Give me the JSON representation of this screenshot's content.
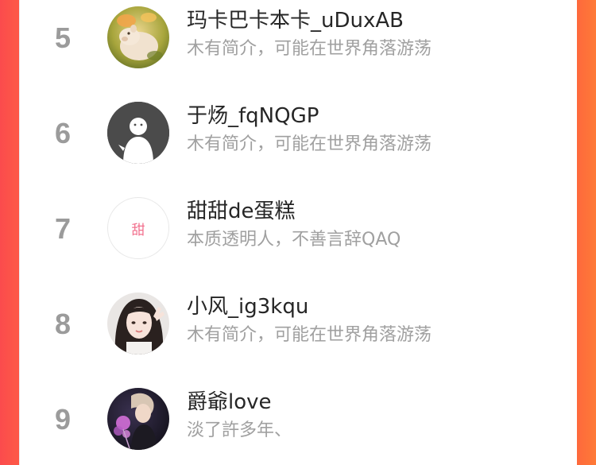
{
  "colors": {
    "rank": "#9b9b9b",
    "name": "#262626",
    "bio": "#a0a0a0",
    "frame_left": "#fb4b4d",
    "frame_right": "#fe7a37",
    "text_avatar": "#f2708d"
  },
  "leaderboard": {
    "rows": [
      {
        "rank": "5",
        "name": "玛卡巴卡本卡_uDuxAB",
        "bio": "木有简介，可能在世界角落游荡",
        "avatar_icon": "pig-photo-avatar"
      },
      {
        "rank": "6",
        "name": "于炀_fqNQGP",
        "bio": "木有简介，可能在世界角落游荡",
        "avatar_icon": "default-ghost-avatar"
      },
      {
        "rank": "7",
        "name": "甜甜de蛋糕",
        "bio": "本质透明人，不善言辞QAQ",
        "avatar_icon": "text-avatar",
        "avatar_text": "甜"
      },
      {
        "rank": "8",
        "name": "小风_ig3kqu",
        "bio": "木有简介，可能在世界角落游荡",
        "avatar_icon": "girl-photo-avatar"
      },
      {
        "rank": "9",
        "name": "爵爺love",
        "bio": "淡了許多年、",
        "avatar_icon": "anime-photo-avatar"
      }
    ]
  }
}
